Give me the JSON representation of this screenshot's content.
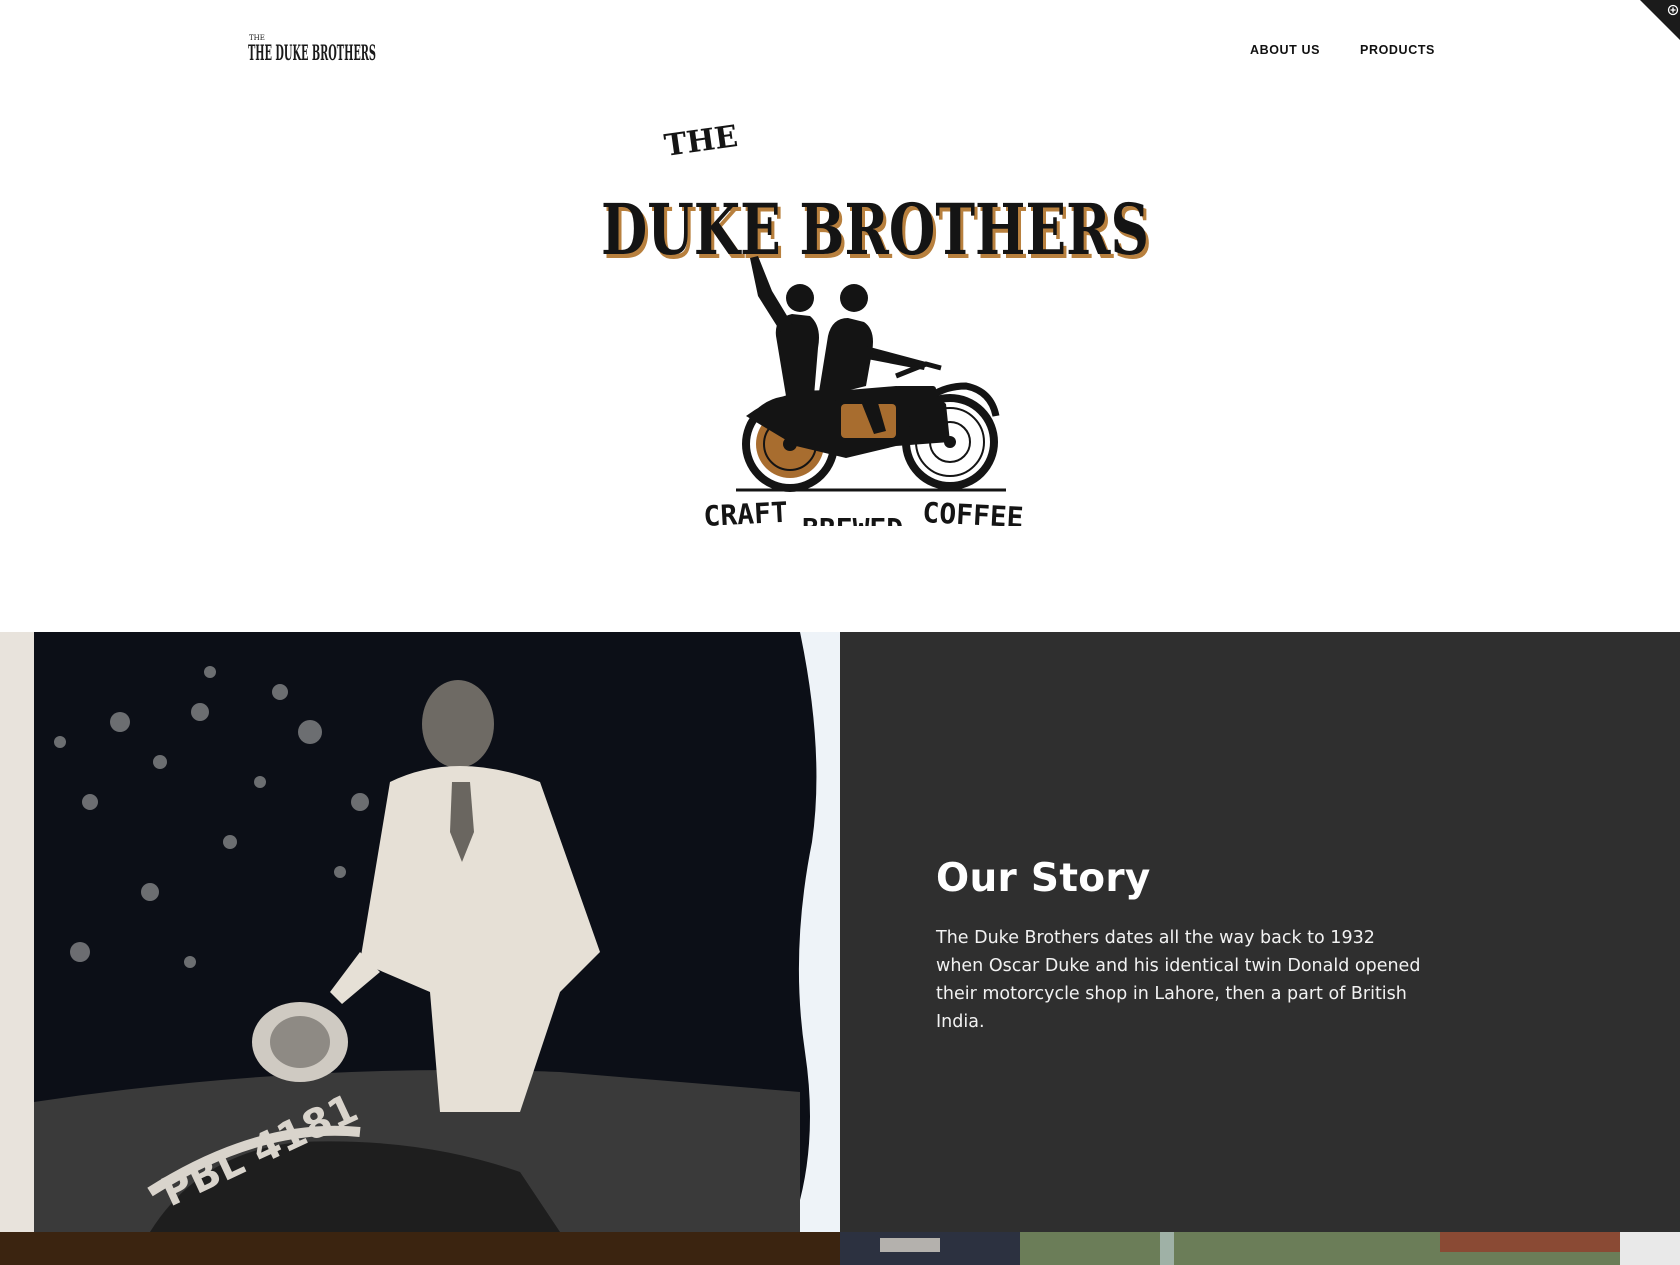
{
  "header": {
    "brand_small": "THE DUKE BROTHERS",
    "nav": [
      {
        "label": "ABOUT US"
      },
      {
        "label": "PRODUCTS"
      }
    ]
  },
  "hero": {
    "logo_the": "THE",
    "logo_name": "DUKE BROTHERS",
    "tagline": [
      "CRAFT",
      "BREWED",
      "COFFEE"
    ]
  },
  "story": {
    "title": "Our Story",
    "body": "The Duke Brothers dates all the way back to 1932 when Oscar Duke and his identical twin Donald opened their motorcycle shop in Lahore, then a part of British India.",
    "photo_plate": "PBL 4181"
  },
  "colors": {
    "panel_bg": "#2f2f2f",
    "accent_gold": "#b8803e",
    "bottom_brown": "#3b2410"
  }
}
